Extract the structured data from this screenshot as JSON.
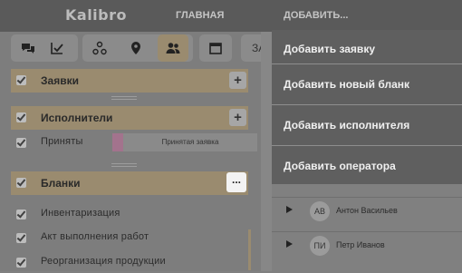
{
  "app": {
    "logo": "Kalibro"
  },
  "nav": {
    "home": "ГЛАВНАЯ",
    "add": "ДОБАВИТЬ..."
  },
  "toolbar": {
    "icons": [
      "chat-icon",
      "checklist-icon",
      "share-icon",
      "location-pin-icon",
      "users-icon",
      "calendar-icon"
    ],
    "active": "users-icon",
    "truncated_tab": "ЗАЯ"
  },
  "sections": {
    "requests": {
      "label": "Заявки",
      "add": "+"
    },
    "executors": {
      "label": "Исполнители",
      "add": "+"
    },
    "forms": {
      "label": "Бланки",
      "menu": "..."
    }
  },
  "executors_rows": [
    {
      "label": "Приняты",
      "bar_label": "Принятая заявка"
    }
  ],
  "form_rows": [
    {
      "label": "Инвентаризация"
    },
    {
      "label": "Акт выполнения работ"
    },
    {
      "label": "Реорганизация продукции"
    }
  ],
  "people": [
    {
      "initials": "АВ",
      "name": "Антон Васильев"
    },
    {
      "initials": "ПИ",
      "name": "Петр Иванов"
    }
  ],
  "dropdown": {
    "items": [
      "Добавить заявку",
      "Добавить новый бланк",
      "Добавить исполнителя",
      "Добавить оператора"
    ]
  },
  "colors": {
    "section_bg": "#9a8b6f",
    "accent_pink": "#a3738d",
    "menu_bg": "#5f5f5f"
  }
}
